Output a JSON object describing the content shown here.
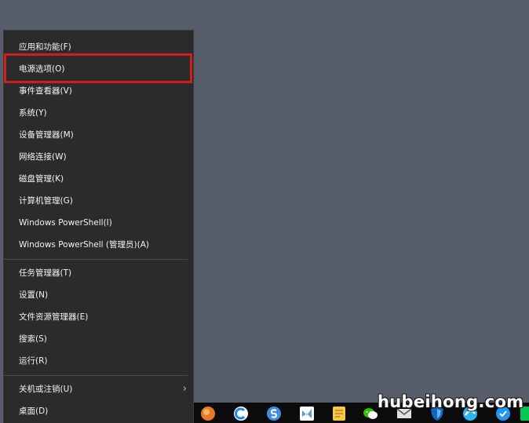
{
  "context_menu": {
    "group1": [
      {
        "label": "应用和功能(F)"
      },
      {
        "label": "电源选项(O)"
      },
      {
        "label": "事件查看器(V)"
      },
      {
        "label": "系统(Y)"
      },
      {
        "label": "设备管理器(M)"
      },
      {
        "label": "网络连接(W)"
      },
      {
        "label": "磁盘管理(K)"
      },
      {
        "label": "计算机管理(G)"
      },
      {
        "label": "Windows PowerShell(I)"
      },
      {
        "label": "Windows PowerShell (管理员)(A)"
      }
    ],
    "group2": [
      {
        "label": "任务管理器(T)"
      },
      {
        "label": "设置(N)"
      },
      {
        "label": "文件资源管理器(E)"
      },
      {
        "label": "搜索(S)"
      },
      {
        "label": "运行(R)"
      }
    ],
    "group3": [
      {
        "label": "关机或注销(U)",
        "has_submenu": true,
        "icon": "chevron-right-icon"
      },
      {
        "label": "桌面(D)"
      }
    ],
    "highlighted_item": "电源选项(O)",
    "highlight_color": "#d21d1d"
  },
  "taskbar": {
    "icons": [
      {
        "name": "orange-app-icon",
        "color": "#e8782a"
      },
      {
        "name": "blue-c-app-icon",
        "color": "#1e88e5"
      },
      {
        "name": "sogou-s-icon",
        "color": "#3a8fe0"
      },
      {
        "name": "visual-studio-icon",
        "color": "#5b9bd5"
      },
      {
        "name": "notes-app-icon",
        "color": "#f2c94c"
      },
      {
        "name": "wechat-icon",
        "color": "#2dc100"
      },
      {
        "name": "mail-icon",
        "color": "#e0e0e0"
      },
      {
        "name": "shield-app-icon",
        "color": "#1565c0"
      },
      {
        "name": "browser-icon",
        "color": "#29b6f6"
      },
      {
        "name": "blue-round-icon",
        "color": "#2196f3"
      },
      {
        "name": "green-app-icon",
        "color": "#00c853"
      }
    ]
  },
  "watermark": {
    "text": "hubeihong.com"
  }
}
